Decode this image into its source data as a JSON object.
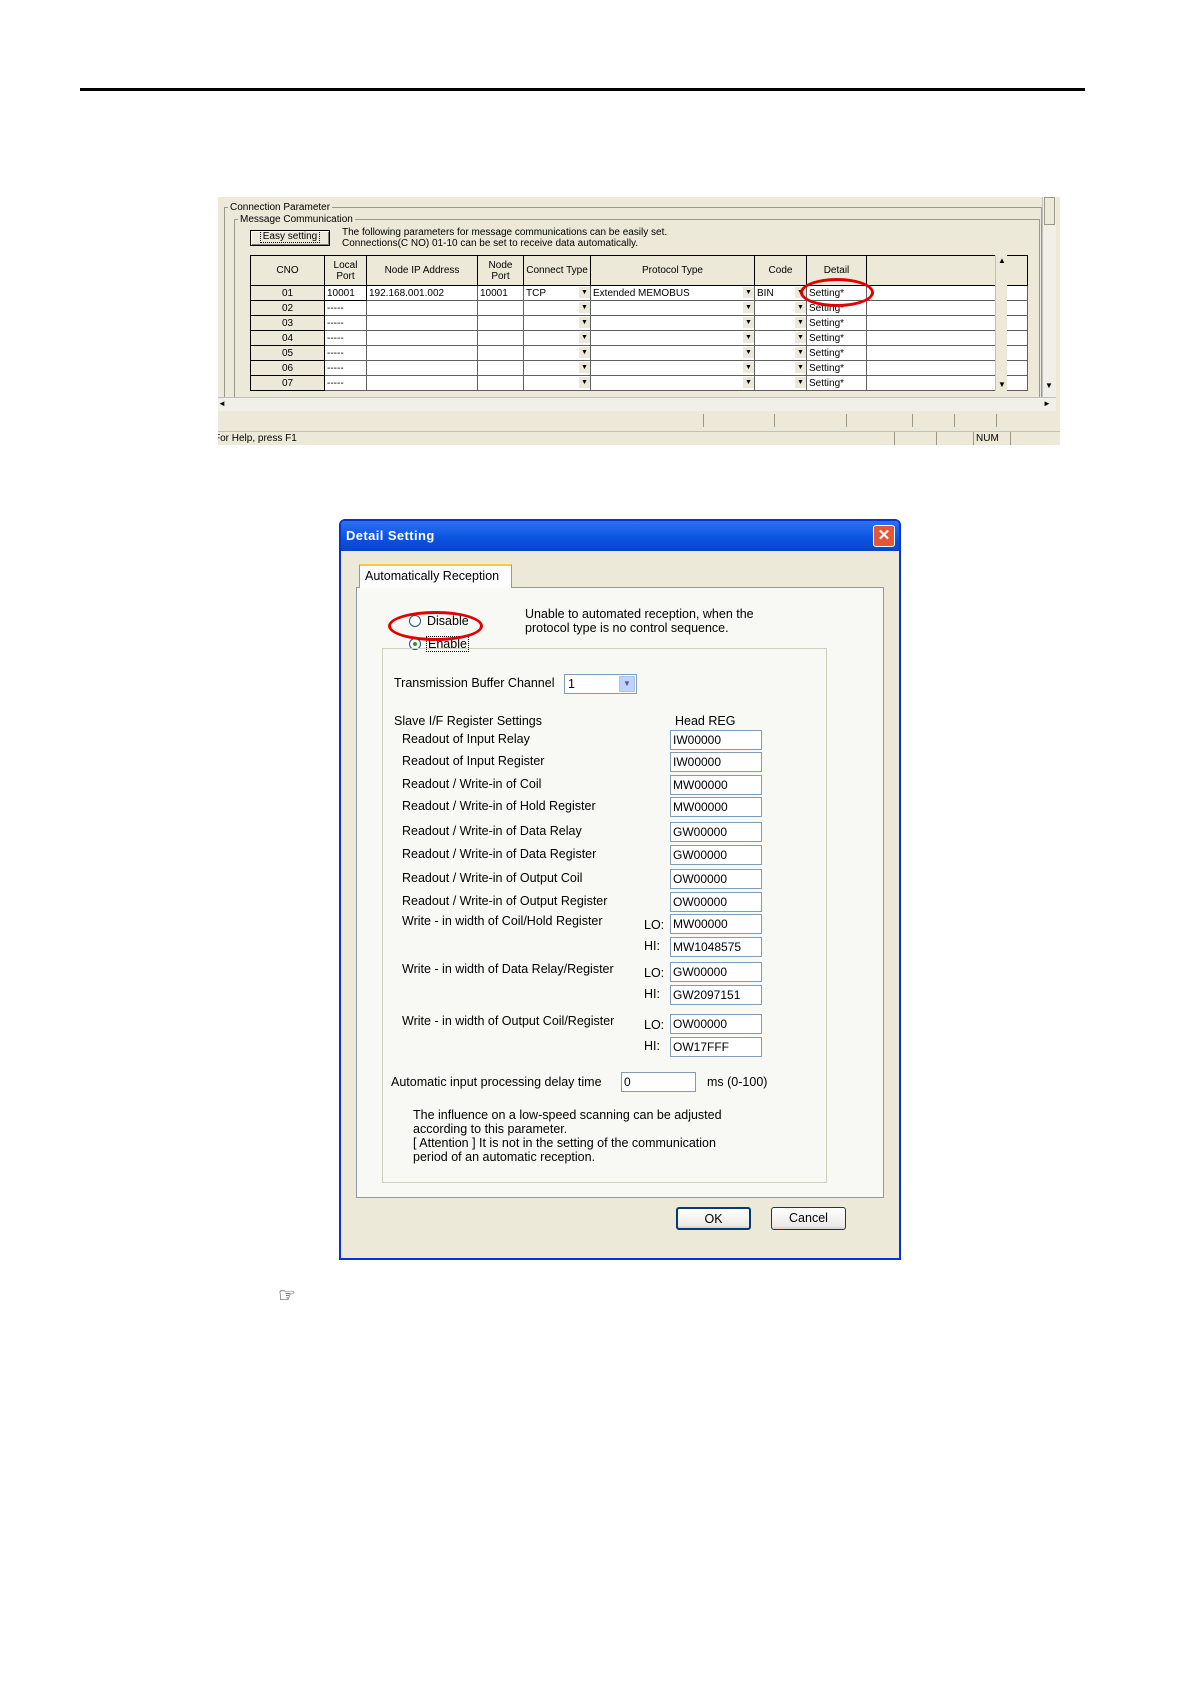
{
  "connection_screen": {
    "group_title": "Connection Parameter",
    "subgroup_title": "Message Communication",
    "easy_setting_button": "Easy setting",
    "description_lines": [
      "The following parameters for message communications can be easily set.",
      "Connections(C NO) 01-10 can be set to receive data automatically."
    ],
    "columns": [
      "CNO",
      "Local Port",
      "Node IP Address",
      "Node Port",
      "Connect Type",
      "Protocol Type",
      "Code",
      "Detail"
    ],
    "rows": [
      {
        "cno": "01",
        "local_port": "10001",
        "ip": "192.168.001.002",
        "node_port": "10001",
        "connect_type": "TCP",
        "protocol_type": "Extended MEMOBUS",
        "code": "BIN",
        "detail": "Setting*"
      },
      {
        "cno": "02",
        "local_port": "-----",
        "ip": "",
        "node_port": "",
        "connect_type": "",
        "protocol_type": "",
        "code": "",
        "detail": "Setting*"
      },
      {
        "cno": "03",
        "local_port": "-----",
        "ip": "",
        "node_port": "",
        "connect_type": "",
        "protocol_type": "",
        "code": "",
        "detail": "Setting*"
      },
      {
        "cno": "04",
        "local_port": "-----",
        "ip": "",
        "node_port": "",
        "connect_type": "",
        "protocol_type": "",
        "code": "",
        "detail": "Setting*"
      },
      {
        "cno": "05",
        "local_port": "-----",
        "ip": "",
        "node_port": "",
        "connect_type": "",
        "protocol_type": "",
        "code": "",
        "detail": "Setting*"
      },
      {
        "cno": "06",
        "local_port": "-----",
        "ip": "",
        "node_port": "",
        "connect_type": "",
        "protocol_type": "",
        "code": "",
        "detail": "Setting*"
      },
      {
        "cno": "07",
        "local_port": "-----",
        "ip": "",
        "node_port": "",
        "connect_type": "",
        "protocol_type": "",
        "code": "",
        "detail": "Setting*"
      }
    ],
    "status_help": "For Help, press F1",
    "status_num": "NUM",
    "highlight_color": "#e00000"
  },
  "detail_dialog": {
    "title": "Detail Setting",
    "close_glyph": "✕",
    "tab_label": "Automatically Reception",
    "radio_disable": "Disable",
    "radio_enable": "Enable",
    "selected_radio": "Enable",
    "note_lines": [
      "Unable to automated reception, when the",
      "protocol type is no control sequence."
    ],
    "transmission_label": "Transmission Buffer Channel",
    "transmission_value": "1",
    "slave_if_label": "Slave I/F Register Settings",
    "head_reg_label": "Head REG",
    "registers": [
      {
        "label": "Readout of Input Relay",
        "value": "IW00000"
      },
      {
        "label": "Readout of Input Register",
        "value": "IW00000"
      },
      {
        "label": "Readout / Write-in of Coil",
        "value": "MW00000"
      },
      {
        "label": "Readout / Write-in of Hold Register",
        "value": "MW00000"
      },
      {
        "label": "Readout / Write-in of Data Relay",
        "value": "GW00000"
      },
      {
        "label": "Readout / Write-in of Data Register",
        "value": "GW00000"
      },
      {
        "label": "Readout / Write-in of Output Coil",
        "value": "OW00000"
      },
      {
        "label": "Readout / Write-in of Output Register",
        "value": "OW00000"
      }
    ],
    "widths": [
      {
        "label": "Write - in width of Coil/Hold Register",
        "lo": "MW00000",
        "hi": "MW1048575"
      },
      {
        "label": "Write - in width of Data Relay/Register",
        "lo": "GW00000",
        "hi": "GW2097151"
      },
      {
        "label": "Write - in width of Output Coil/Register",
        "lo": "OW00000",
        "hi": "OW17FFF"
      }
    ],
    "lo_label": "LO:",
    "hi_label": "HI:",
    "delay_label": "Automatic input processing delay time",
    "delay_value": "0",
    "delay_unit": "ms (0-100)",
    "influence_lines": [
      "The influence on a low-speed scanning can be adjusted",
      "according to this parameter.",
      "[ Attention ] It is not in the setting of the communication",
      "period of an automatic reception."
    ],
    "ok_button": "OK",
    "cancel_button": "Cancel"
  },
  "reference_icon": "☞"
}
